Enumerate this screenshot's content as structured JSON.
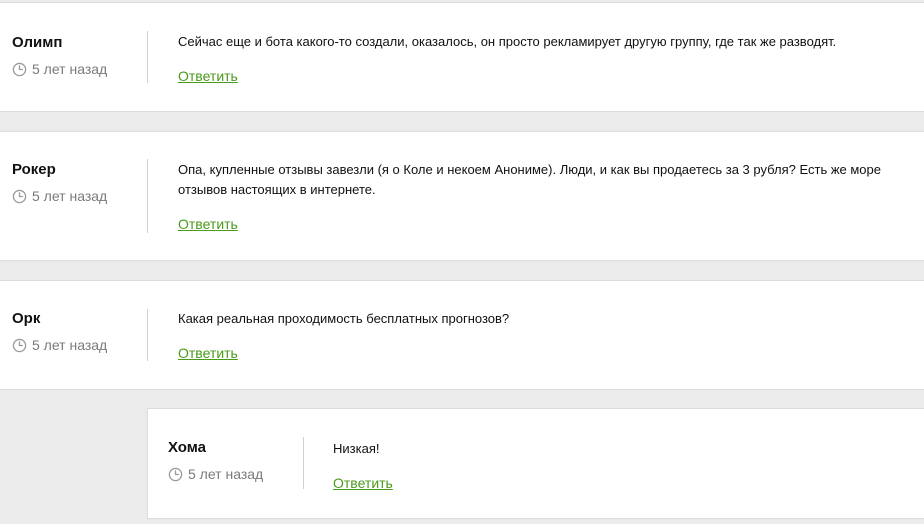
{
  "comments": [
    {
      "author": "Олимп",
      "time": "5 лет назад",
      "text": "Сейчас еще и бота какого-то создали, оказалось, он просто рекламирует другую группу, где так же разводят.",
      "reply_label": "Ответить"
    },
    {
      "author": "Рокер",
      "time": "5 лет назад",
      "text": "Опа, купленные отзывы завезли (я о Коле и некоем Анониме). Люди, и как вы продаетесь за 3 рубля? Есть же море отзывов настоящих в интернете.",
      "reply_label": "Ответить"
    },
    {
      "author": "Орк",
      "time": "5 лет назад",
      "text": "Какая реальная проходимость бесплатных прогнозов?",
      "reply_label": "Ответить"
    },
    {
      "author": "Хома",
      "time": "5 лет назад",
      "text": "Низкая!",
      "reply_label": "Ответить"
    }
  ],
  "colors": {
    "link": "#4a9a1a",
    "muted": "#7a7a7a",
    "background": "#ebebeb"
  },
  "icons": {
    "time": "clock-icon"
  }
}
